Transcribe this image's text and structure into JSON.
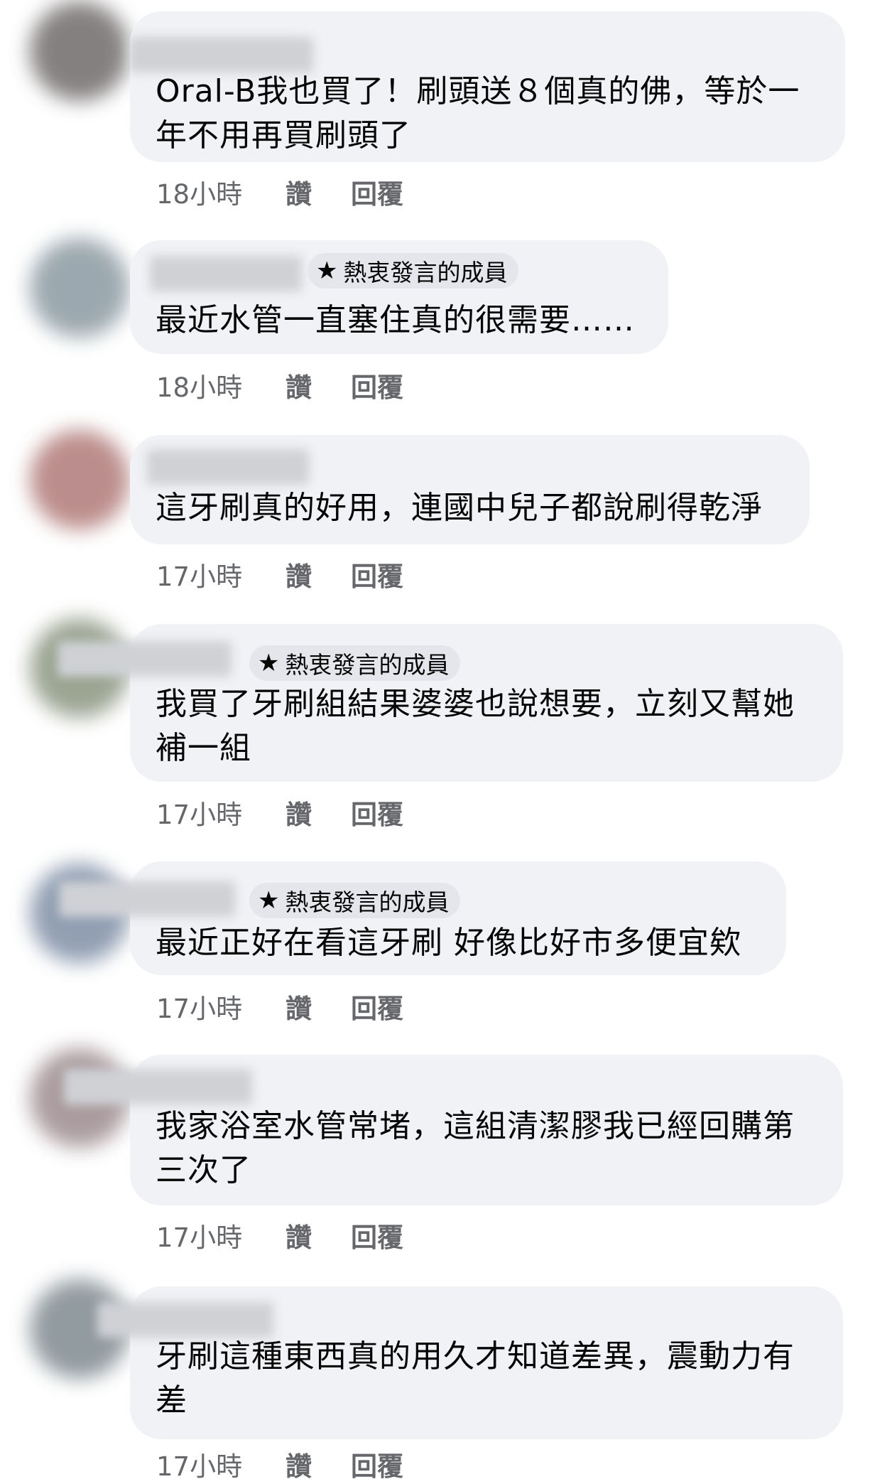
{
  "comments": [
    {
      "badge": "",
      "text": "Oral-B我也買了！刷頭送８個真的佛，等於一年不用再買刷頭了",
      "time": "18小時",
      "like": "讚",
      "reply": "回覆"
    },
    {
      "badge": "熱衷發言的成員",
      "text": "最近水管一直塞住真的很需要……",
      "time": "18小時",
      "like": "讚",
      "reply": "回覆"
    },
    {
      "badge": "",
      "text": "這牙刷真的好用，連國中兒子都說刷得乾淨",
      "time": "17小時",
      "like": "讚",
      "reply": "回覆"
    },
    {
      "badge": "熱衷發言的成員",
      "text": "我買了牙刷組結果婆婆也說想要，立刻又幫她補一組",
      "time": "17小時",
      "like": "讚",
      "reply": "回覆"
    },
    {
      "badge": "熱衷發言的成員",
      "text": "最近正好在看這牙刷 好像比好市多便宜欸",
      "time": "17小時",
      "like": "讚",
      "reply": "回覆"
    },
    {
      "badge": "",
      "text": "我家浴室水管常堵，這組清潔膠我已經回購第三次了",
      "time": "17小時",
      "like": "讚",
      "reply": "回覆"
    },
    {
      "badge": "",
      "text": "牙刷這種東西真的用久才知道差異，震動力有差",
      "time": "17小時",
      "like": "讚",
      "reply": "回覆"
    }
  ],
  "icons": {
    "badge": "star-icon"
  },
  "colors": {
    "bubble": "#f0f2f5",
    "meta": "#65676b",
    "text": "#050505"
  }
}
